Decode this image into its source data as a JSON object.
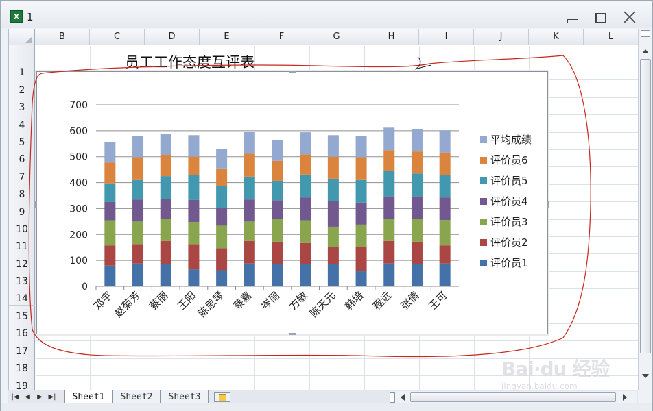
{
  "window": {
    "title": "1",
    "app_icon_label": "X"
  },
  "columns": [
    "B",
    "C",
    "D",
    "E",
    "F",
    "G",
    "H",
    "I",
    "J",
    "K",
    "L"
  ],
  "rows": [
    "1",
    "2",
    "3",
    "4",
    "5",
    "6",
    "7",
    "8",
    "9",
    "10",
    "11",
    "12",
    "13",
    "14",
    "15",
    "16",
    "17",
    "18",
    "19"
  ],
  "sheet_title": "员工工作态度互评表",
  "sheet_tabs": [
    "Sheet1",
    "Sheet2",
    "Sheet3"
  ],
  "active_sheet": "Sheet1",
  "watermark": {
    "logo": "Bai·du 经验",
    "site": "jingyan.baidu.com"
  },
  "chart_data": {
    "type": "bar",
    "stacked": true,
    "categories": [
      "邓宇",
      "赵菊芳",
      "蔡丽",
      "王阳",
      "陈思琴",
      "蔡嘉",
      "岑丽",
      "方敏",
      "陈天元",
      "韩培",
      "程远",
      "张倩",
      "王可"
    ],
    "ylim": [
      0,
      700
    ],
    "yticks": [
      0,
      100,
      200,
      300,
      400,
      500,
      600,
      700
    ],
    "grid": true,
    "legend_position": "right",
    "series": [
      {
        "name": "评价员1",
        "color": "#4472a8",
        "values": [
          80,
          88,
          87,
          65,
          62,
          88,
          87,
          87,
          85,
          58,
          88,
          85,
          88
        ]
      },
      {
        "name": "评价员2",
        "color": "#aa4644",
        "values": [
          78,
          75,
          88,
          98,
          85,
          87,
          85,
          80,
          68,
          95,
          87,
          87,
          70
        ]
      },
      {
        "name": "评价员3",
        "color": "#89a54e",
        "values": [
          97,
          87,
          85,
          85,
          87,
          75,
          87,
          88,
          77,
          85,
          85,
          88,
          98
        ]
      },
      {
        "name": "评价员4",
        "color": "#71588f",
        "values": [
          70,
          85,
          78,
          85,
          68,
          85,
          73,
          88,
          100,
          85,
          87,
          87,
          87
        ]
      },
      {
        "name": "评价员5",
        "color": "#4198af",
        "values": [
          72,
          75,
          87,
          97,
          85,
          88,
          75,
          88,
          85,
          87,
          98,
          88,
          85
        ]
      },
      {
        "name": "评价员6",
        "color": "#db843d",
        "values": [
          80,
          88,
          80,
          70,
          68,
          88,
          77,
          78,
          85,
          88,
          80,
          85,
          88
        ]
      },
      {
        "name": "平均成绩",
        "color": "#93a9cf",
        "values": [
          80,
          82,
          83,
          83,
          76,
          85,
          80,
          85,
          83,
          83,
          87,
          87,
          86
        ]
      }
    ]
  }
}
